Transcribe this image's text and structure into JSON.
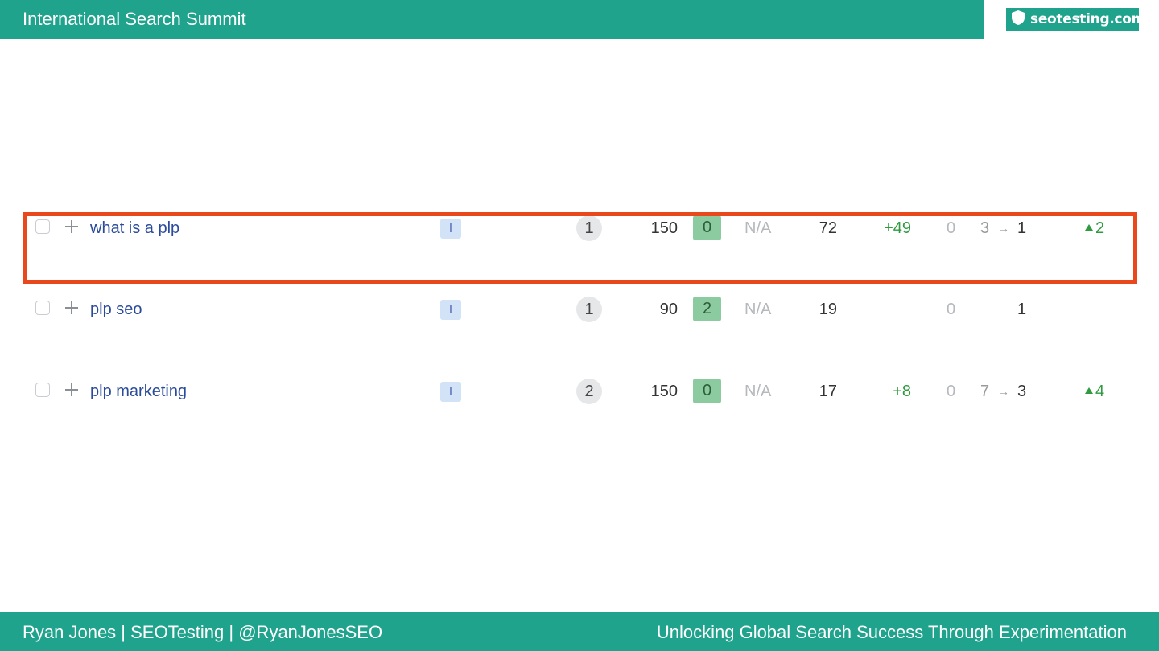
{
  "header": {
    "title": "International Search Summit",
    "logo_text": "seotesting.com",
    "bg_color": "#1fa38c"
  },
  "footer": {
    "left_text": "Ryan Jones | SEOTesting | @RyanJonesSEO",
    "right_text": "Unlocking Global Search Success Through Experimentation"
  },
  "keywords": [
    {
      "keyword": "what is a plp",
      "intent": "I",
      "position": "1",
      "volume": "150",
      "kd": "0",
      "cpc": "N/A",
      "traffic": "72",
      "change": "+49",
      "zero": "0",
      "prev_rank": "3",
      "current_rank": "1",
      "delta": "2",
      "highlighted": true
    },
    {
      "keyword": "plp seo",
      "intent": "I",
      "position": "1",
      "volume": "90",
      "kd": "2",
      "cpc": "N/A",
      "traffic": "19",
      "change": "",
      "zero": "0",
      "prev_rank": "",
      "current_rank": "1",
      "delta": "",
      "highlighted": false
    },
    {
      "keyword": "plp marketing",
      "intent": "I",
      "position": "2",
      "volume": "150",
      "kd": "0",
      "cpc": "N/A",
      "traffic": "17",
      "change": "+8",
      "zero": "0",
      "prev_rank": "7",
      "current_rank": "3",
      "delta": "4",
      "highlighted": false
    }
  ],
  "colors": {
    "highlight_border": "#e8481c",
    "link": "#2a4a9b",
    "positive": "#2f9a3f",
    "kd_badge": "#8ccb9f"
  },
  "icons": [
    "shield-icon",
    "checkbox-icon",
    "plus-icon",
    "arrow-right-icon",
    "triangle-up-icon"
  ]
}
